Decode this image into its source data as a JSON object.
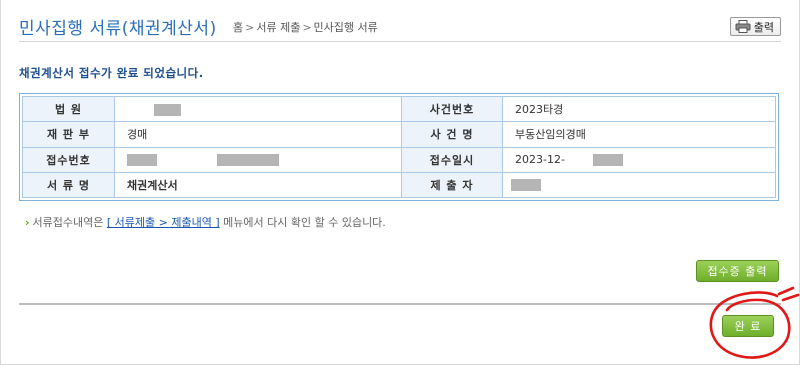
{
  "header": {
    "title": "민사집행 서류(채권계산서)",
    "breadcrumb": [
      "홈",
      "서류 제출",
      "민사집행 서류"
    ],
    "breadcrumb_sep": ">",
    "print_label": "출력"
  },
  "message": "채권계산서 접수가 완료 되었습니다.",
  "info": {
    "rows": [
      {
        "label1": "법 원",
        "value1": "",
        "label2": "사건번호",
        "value2": "2023타경"
      },
      {
        "label1": "재 판 부",
        "value1": "경매",
        "label2": "사 건 명",
        "value2": "부동산임의경매"
      },
      {
        "label1": "접수번호",
        "value1": "",
        "label2": "접수일시",
        "value2": "2023-12-"
      },
      {
        "label1": "서 류 명",
        "value1": "채권계산서",
        "label2": "제 출 자",
        "value2": ""
      }
    ]
  },
  "note": {
    "prefix": "서류접수내역은",
    "link": "[ 서류제출 > 제출내역 ]",
    "suffix": "메뉴에서 다시 확인 할 수 있습니다."
  },
  "buttons": {
    "receipt": "접수증 출력",
    "done": "완 료"
  },
  "colors": {
    "title": "#2a6fb8",
    "message": "#1d4f91",
    "button_green": "#7dbb36",
    "annotation_red": "#e01818"
  }
}
